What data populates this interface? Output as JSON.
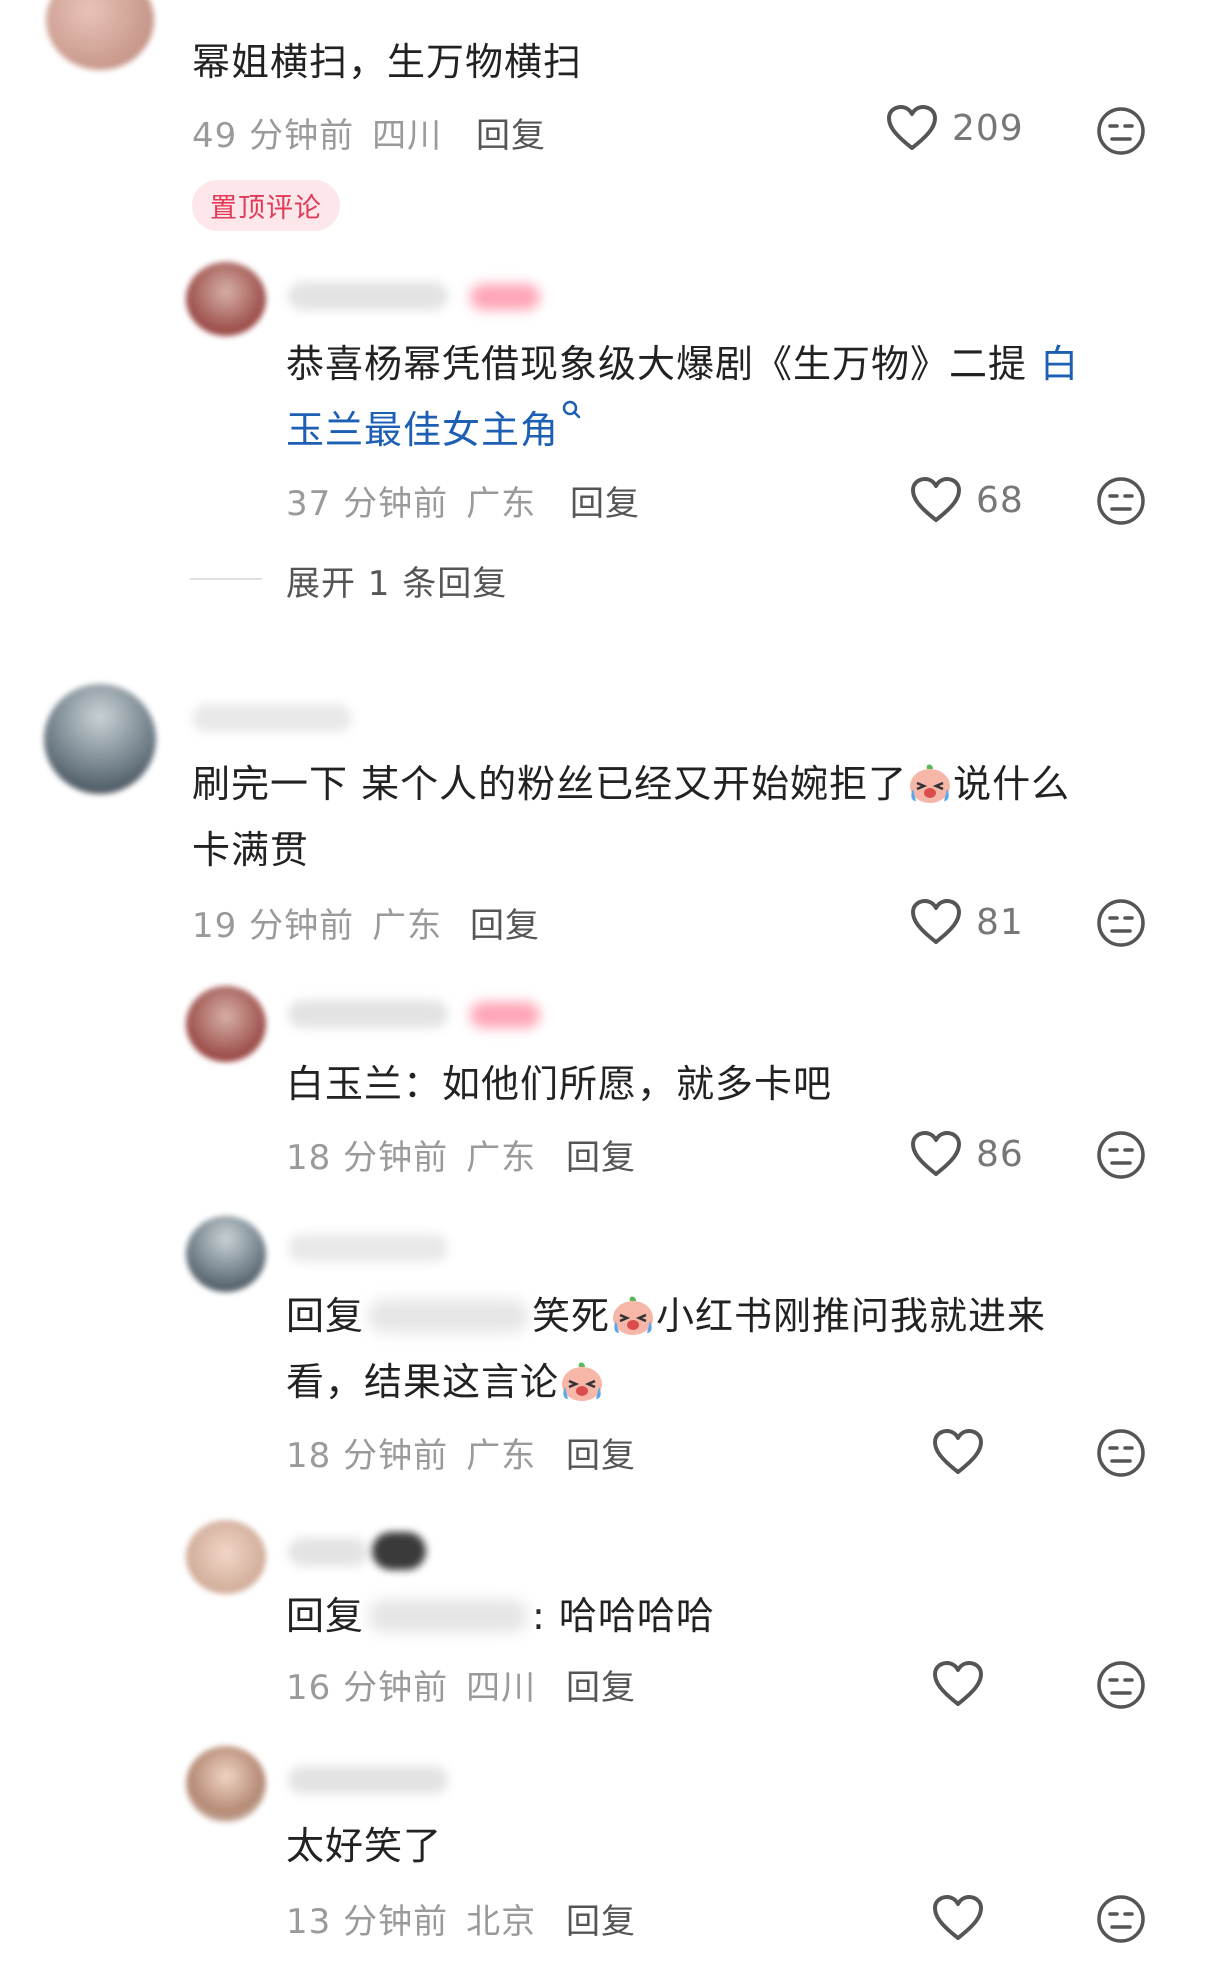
{
  "comments": [
    {
      "text": "幂姐横扫，生万物横扫",
      "time": "49 分钟前",
      "location": "四川",
      "reply_label": "回复",
      "likes": "209",
      "pinned_label": "置顶评论"
    },
    {
      "text_prefix": "恭喜杨幂凭借现象级大爆剧《生万物》二提",
      "link_text_line1": "白",
      "link_text_line2": "玉兰最佳女主角",
      "time": "37 分钟前",
      "location": "广东",
      "reply_label": "回复",
      "likes": "68",
      "expand_label": "展开 1 条回复"
    },
    {
      "text_line1": "刷完一下 某个人的粉丝已经又开始婉拒了",
      "text_line1_tail": "说什么",
      "text_line2": "卡满贯",
      "time": "19 分钟前",
      "location": "广东",
      "reply_label": "回复",
      "likes": "81"
    },
    {
      "text": "白玉兰：如他们所愿，就多卡吧",
      "time": "18 分钟前",
      "location": "广东",
      "reply_label": "回复",
      "likes": "86"
    },
    {
      "text_prefix": "回复",
      "text_mid": "笑死",
      "text_tail": "小红书刚推问我就进来",
      "text_line2": "看，结果这言论",
      "time": "18 分钟前",
      "location": "广东",
      "reply_label": "回复",
      "likes": ""
    },
    {
      "text_prefix": "回复",
      "text_tail": ": 哈哈哈哈",
      "time": "16 分钟前",
      "location": "四川",
      "reply_label": "回复",
      "likes": ""
    },
    {
      "text": "太好笑了",
      "time": "13 分钟前",
      "location": "北京",
      "reply_label": "回复",
      "likes": ""
    }
  ],
  "icons": {
    "like": "heart-outline-icon",
    "dislike": "neutral-face-icon",
    "emoji": "crying-laughing-emoji"
  },
  "colors": {
    "link": "#1c5fb3",
    "pin_text": "#e33a58",
    "pin_bg": "#fde7ea",
    "meta": "#9a9a9a"
  }
}
